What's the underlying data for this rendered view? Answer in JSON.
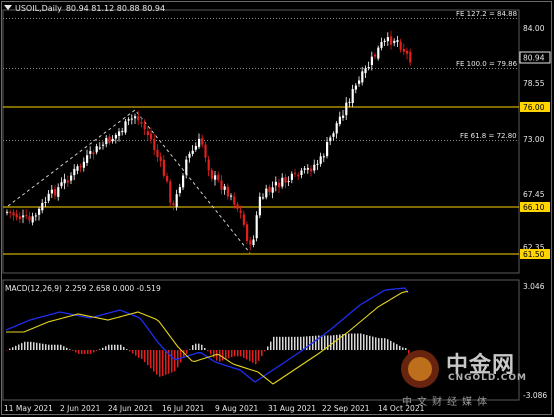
{
  "header": {
    "symbol": "USOIL,Daily",
    "ohlc": "80.94 81.12 80.88 80.94"
  },
  "macd": {
    "label": "MACD(12,26,9)",
    "values": "2.259 2.658 0.000 -0.519"
  },
  "price_axis": {
    "ticks": [
      "84.00",
      "78.55",
      "73.00",
      "67.45",
      "62.35"
    ],
    "current_price": "80.94"
  },
  "levels": [
    {
      "label": "76.00",
      "color": "#ffd400"
    },
    {
      "label": "66.10",
      "color": "#ffd400"
    },
    {
      "label": "61.50",
      "color": "#ffd400"
    }
  ],
  "fib_levels": [
    {
      "label": "FE 127.2 = 84.88"
    },
    {
      "label": "FE 100.0 = 79.86"
    },
    {
      "label": "FE 61.8 = 72.80"
    }
  ],
  "macd_axis": {
    "top": "3.046",
    "bottom": "-3.086"
  },
  "time_axis": [
    "11 May 2021",
    "2 Jun 2021",
    "24 Jun 2021",
    "16 Jul 2021",
    "9 Aug 2021",
    "31 Aug 2021",
    "22 Sep 2021",
    "14 Oct 2021"
  ],
  "watermark": {
    "name": "中金网",
    "site": "CNGOLD.COM",
    "tagline": "中文财经媒体"
  },
  "colors": {
    "bull": "#ffffff",
    "bear": "#e0201e",
    "level": "#ffd400",
    "macd_line": "#1e2ef0",
    "signal_line": "#e6d41e"
  }
}
